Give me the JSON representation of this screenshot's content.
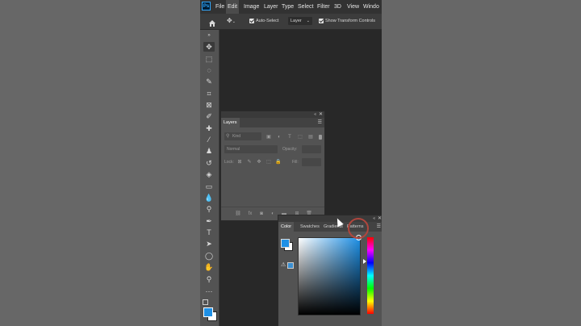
{
  "app": {
    "logo_text": "Ps",
    "menu": [
      "File",
      "Edit",
      "Image",
      "Layer",
      "Type",
      "Select",
      "Filter",
      "3D",
      "View",
      "Windo"
    ],
    "active_menu": "Edit"
  },
  "options_bar": {
    "auto_select_label": "Auto-Select",
    "layer_dropdown": "Layer",
    "show_transform_label": "Show Transform Controls"
  },
  "layers_panel": {
    "tab": "Layers",
    "kind_placeholder": "Kind",
    "blend_mode": "Normal",
    "opacity_label": "Opacity:",
    "lock_label": "Lock:",
    "fill_label": "Fill:"
  },
  "color_panel": {
    "tabs": [
      "Color",
      "Swatches",
      "Gradients",
      "Patterns"
    ],
    "active_tab": "Color",
    "foreground_color": "#1e90e6",
    "background_color": "#ffffff"
  },
  "colors": {
    "accent": "#1e90e6",
    "canvas_bg": "#282828",
    "panel_bg": "#535353"
  }
}
